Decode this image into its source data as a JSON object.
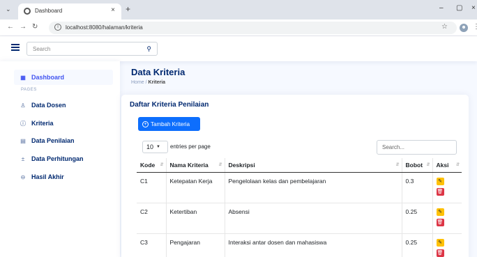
{
  "browser": {
    "tab_title": "Dashboard",
    "url": "localhost:8080/halaman/kriteria"
  },
  "header": {
    "search_placeholder": "Search"
  },
  "sidebar": {
    "section_label": "PAGES",
    "items": [
      {
        "label": "Dashboard",
        "icon": "grid-icon"
      },
      {
        "label": "Data Dosen",
        "icon": "person-icon"
      },
      {
        "label": "Kriteria",
        "icon": "question-circle-icon"
      },
      {
        "label": "Data Penilaian",
        "icon": "card-icon"
      },
      {
        "label": "Data Perhitungan",
        "icon": "calculator-icon"
      },
      {
        "label": "Hasil Akhir",
        "icon": "dash-circle-icon"
      }
    ]
  },
  "page": {
    "title": "Data Kriteria",
    "breadcrumb_home": "Home",
    "breadcrumb_sep": " / ",
    "breadcrumb_current": "Kriteria"
  },
  "card": {
    "title": "Daftar Kriteria Penilaian",
    "add_button": "Tambah Kriteria",
    "per_page_value": "10",
    "per_page_label": "entries per page",
    "search_placeholder": "Search..."
  },
  "table": {
    "headers": [
      "Kode",
      "Nama Kriteria",
      "Deskripsi",
      "Bobot",
      "Aksi"
    ],
    "rows": [
      [
        "C1",
        "Ketepatan Kerja",
        "Pengelolaan kelas dan pembelajaran",
        "0.3"
      ],
      [
        "C2",
        "Ketertiban",
        "Absensi",
        "0.25"
      ],
      [
        "C3",
        "Pengajaran",
        "Interaksi antar dosen dan mahasiswa",
        "0.25"
      ]
    ]
  },
  "colors": {
    "primary": "#4154f1",
    "navy": "#012970",
    "button_blue": "#0d6efd",
    "edit_yellow": "#ffc107",
    "delete_red": "#dc3545"
  }
}
